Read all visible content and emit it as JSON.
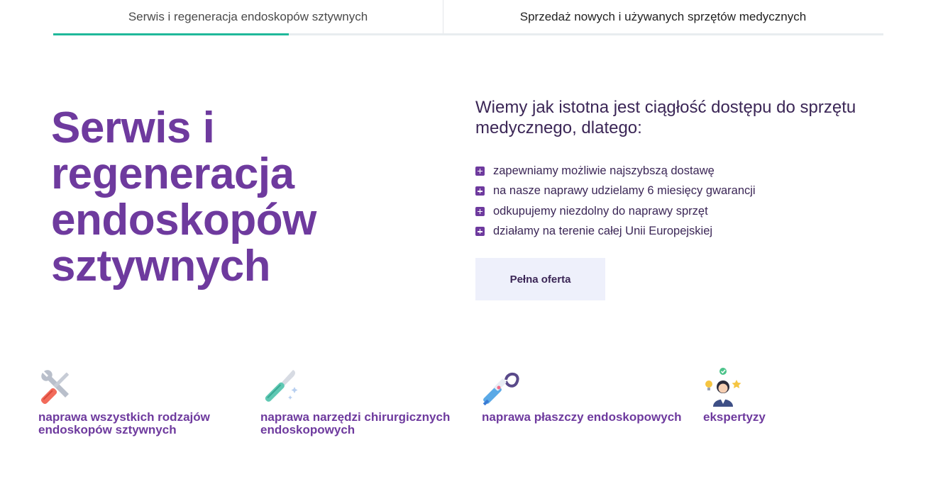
{
  "tabs": [
    {
      "label": "Serwis i regeneracja endoskopów sztywnych",
      "active": true
    },
    {
      "label": "Sprzedaż nowych i używanych sprzętów medycznych",
      "active": false
    }
  ],
  "hero": {
    "title": "Serwis i regeneracja endoskopów sztywnych"
  },
  "intro": {
    "lead": "Wiemy jak istotna jest ciągłość dostępu do sprzętu medycznego, dlatego:",
    "bullets": [
      "zapewniamy możliwie najszybszą dostawę",
      "na nasze naprawy udzielamy 6 miesięcy gwarancji",
      "odkupujemy niezdolny do naprawy sprzęt",
      "działamy na terenie całej Unii Europejskiej"
    ],
    "cta_label": "Pełna oferta"
  },
  "features": [
    {
      "icon": "tools-icon",
      "label": "naprawa wszystkich rodzajów endoskopów sztywnych"
    },
    {
      "icon": "scalpel-icon",
      "label": "naprawa narzędzi chirurgicznych endoskopowych"
    },
    {
      "icon": "endoscope-sheath-icon",
      "label": "naprawa płaszczy endoskopowych"
    },
    {
      "icon": "expert-icon",
      "label": "ekspertyzy"
    }
  ],
  "colors": {
    "accent": "#6e3a9e",
    "tab_indicator": "#1fb89a",
    "cta_background": "#eef0fb",
    "text_dark": "#3b2656"
  }
}
